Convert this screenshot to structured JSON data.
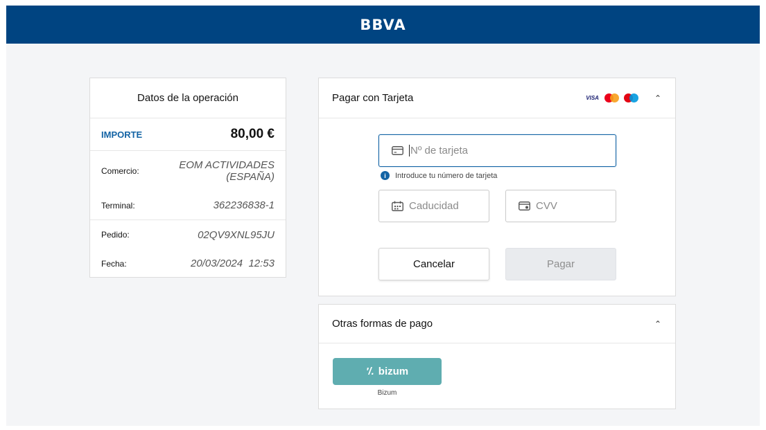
{
  "header": {
    "logo": "BBVA",
    "bg_color": "#004481"
  },
  "operation": {
    "title": "Datos de la operación",
    "amount_label": "IMPORTE",
    "amount_value": "80,00 €",
    "rows": [
      {
        "label": "Comercio:",
        "value": "EOM ACTIVIDADES (ESPAÑA)"
      },
      {
        "label": "Terminal:",
        "value": "362236838-1"
      },
      {
        "label": "Pedido:",
        "value": "02QV9XNL95JU"
      },
      {
        "label": "Fecha:",
        "value": "20/03/2024  12:53"
      }
    ]
  },
  "card_payment": {
    "title": "Pagar con Tarjeta",
    "brands": {
      "visa": "VISA",
      "icons": [
        "mastercard-icon",
        "maestro-icon"
      ]
    },
    "card_number_placeholder": "Nº de tarjeta",
    "card_number_hint": "Introduce tu número de tarjeta",
    "expiry_placeholder": "Caducidad",
    "cvv_placeholder": "CVV",
    "cancel_label": "Cancelar",
    "pay_label": "Pagar"
  },
  "other_payments": {
    "title": "Otras formas de pago",
    "bizum_button_text": "bizum",
    "bizum_caption": "Bizum",
    "bizum_color": "#5fadb0"
  }
}
